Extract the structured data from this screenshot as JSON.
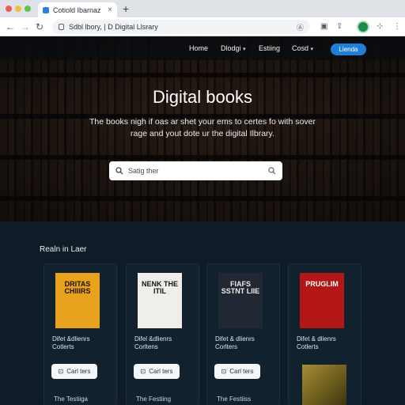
{
  "browser": {
    "tab_title": "Cotiold Ibarnaz",
    "url": "Sdbl lbory, | D  Digital Llsrary",
    "omni_right": "Ⓐ",
    "tab_close": "×",
    "new_tab": "+"
  },
  "nav": {
    "links": [
      "Home",
      "Dlodgi",
      "Estiing",
      "Cosd"
    ],
    "login": "Lienda"
  },
  "hero": {
    "title": "Digital books",
    "subtitle": "The books nigh if oas ar shet your ems to certes fo with sover rage and yout dote ur the digital Ilbrary.",
    "search_placeholder": "Satig ther"
  },
  "section": {
    "title": "Realn in Laer"
  },
  "cards": [
    {
      "cover_text": "DRITAS CHIIIRS",
      "line1": "Difet &dlienrs",
      "line2": "Cotlerts",
      "button": "Carl ters",
      "footer": "The Testiiga",
      "cover_bg": "#e9a21d",
      "cover_fg": "#1a1308"
    },
    {
      "cover_text": "NENK THE ITIL",
      "line1": "Difel &dlienrs",
      "line2": "Corltens",
      "button": "Carl ters",
      "footer": "The Festiing",
      "cover_bg": "#efeee8",
      "cover_fg": "#15130f"
    },
    {
      "cover_text": "FIAFS SSTNT LIIE",
      "line1": "Difet & dlienrs",
      "line2": "Corlters",
      "button": "Carl ters",
      "footer": "The Festiiss",
      "cover_bg": "#1f2833",
      "cover_fg": "#f1ece4"
    },
    {
      "cover_text": "PRUGLIM",
      "line1": "Difet & dlienrs",
      "line2": "Cotlerts",
      "button": "",
      "footer": "",
      "cover_bg": "#b31616",
      "cover_fg": "#ffffff"
    }
  ],
  "colors": {
    "accent": "#1f7fd8",
    "background": "#0f1b26"
  }
}
